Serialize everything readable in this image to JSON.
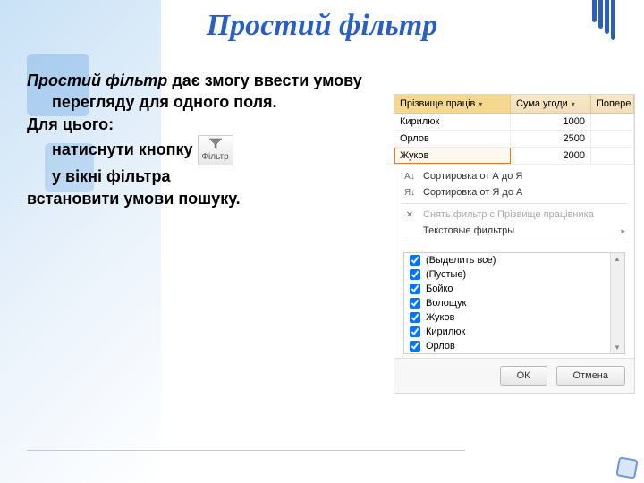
{
  "title": "Простий фільтр",
  "body": {
    "line1_em": "Простий фільтр",
    "line1_rest": " дає змогу ввести умову",
    "line2": "перегляду для одного поля.",
    "line3": "Для цього:",
    "line4": "натиснути кнопку",
    "line5": "у вікні фільтра",
    "line6": "встановити умови пошуку."
  },
  "filterBtn": {
    "label": "Фільтр"
  },
  "table": {
    "headers": [
      "Прізвище праців",
      "Сума угоди",
      "Попере"
    ],
    "rows": [
      {
        "c1": "Кирилюк",
        "c2": "1000",
        "c3": ""
      },
      {
        "c1": "Орлов",
        "c2": "2500",
        "c3": ""
      },
      {
        "c1": "Жуков",
        "c2": "2000",
        "c3": ""
      }
    ]
  },
  "menu": {
    "sortAZ": "Сортировка от А до Я",
    "sortZA": "Сортировка от Я до А",
    "clearFilter": "Снять фильтр с Прізвище працівника",
    "textFilters": "Текстовые фильтры"
  },
  "checks": [
    "(Выделить все)",
    "(Пустые)",
    "Бойко",
    "Волощук",
    "Жуков",
    "Кирилюк",
    "Орлов"
  ],
  "buttons": {
    "ok": "ОК",
    "cancel": "Отмена"
  }
}
